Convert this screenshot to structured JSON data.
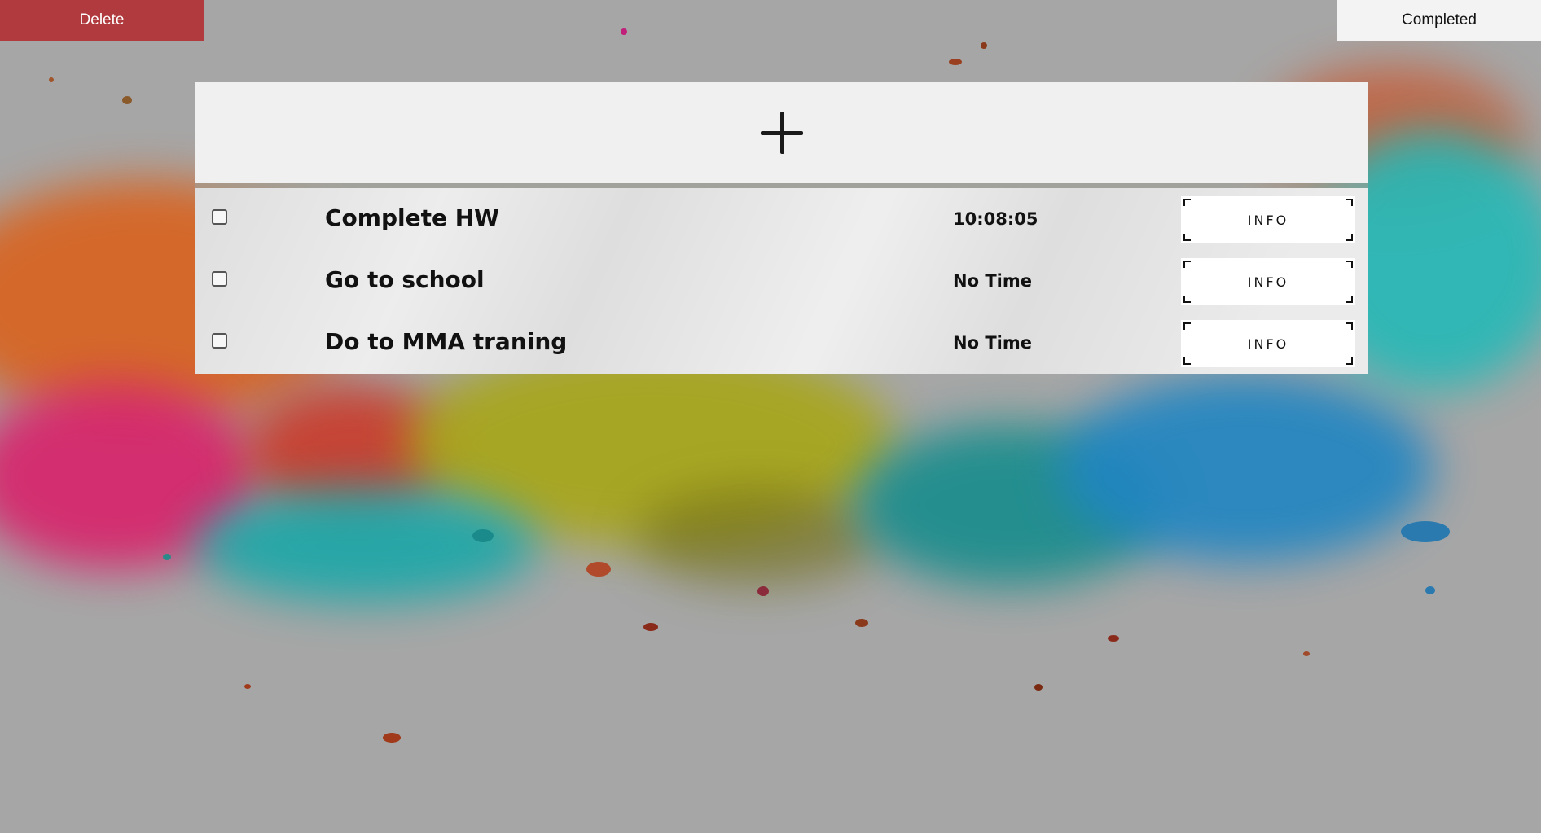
{
  "toolbar": {
    "delete_label": "Delete",
    "completed_label": "Completed"
  },
  "add_panel": {
    "icon": "plus-icon"
  },
  "tasks": [
    {
      "title": "Complete HW",
      "time": "10:08:05",
      "checked": false,
      "info_label": "INFO"
    },
    {
      "title": "Go to school",
      "time": "No Time",
      "checked": false,
      "info_label": "INFO"
    },
    {
      "title": "Do to MMA traning",
      "time": "No Time",
      "checked": false,
      "info_label": "INFO"
    }
  ],
  "colors": {
    "delete_button": "#b03a3d",
    "completed_button": "#f3f3f3",
    "panel": "#f0f0f0",
    "background": "#a6a6a6"
  }
}
